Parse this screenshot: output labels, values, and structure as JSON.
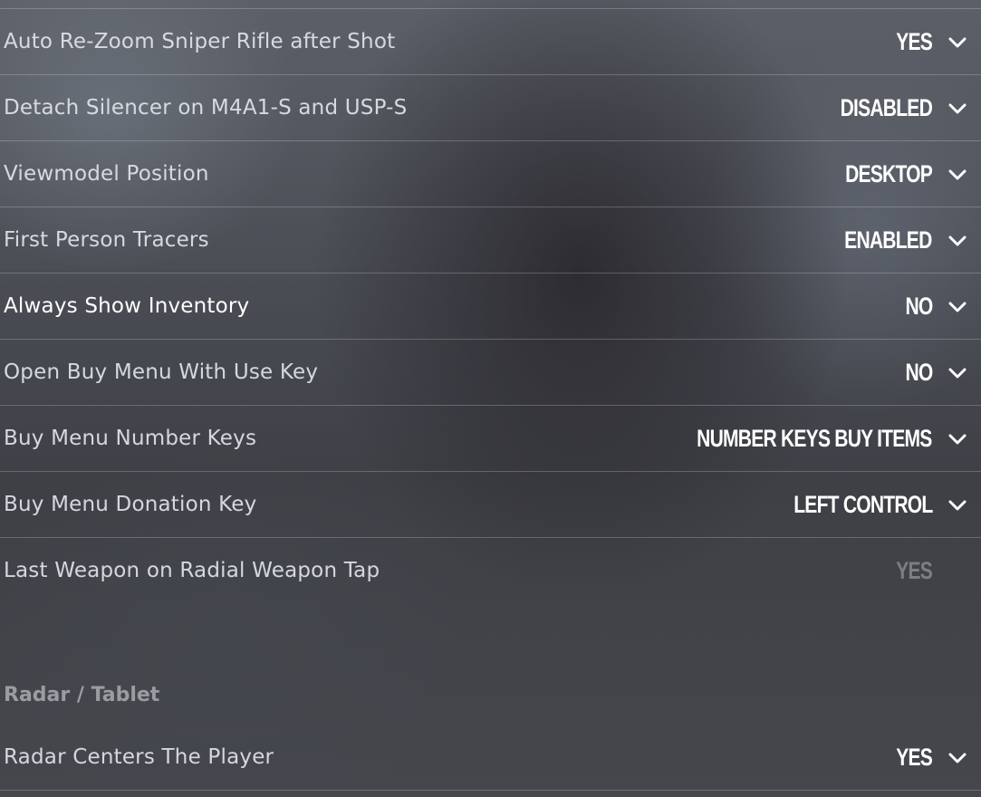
{
  "settings": [
    {
      "label": "Auto Re-Zoom Sniper Rifle after Shot",
      "value": "YES",
      "chevron_icon": "chevron-down-icon"
    },
    {
      "label": "Detach Silencer on M4A1-S and USP-S",
      "value": "DISABLED",
      "chevron_icon": "chevron-down-icon"
    },
    {
      "label": "Viewmodel Position",
      "value": "DESKTOP",
      "chevron_icon": "chevron-down-icon"
    },
    {
      "label": "First Person Tracers",
      "value": "ENABLED",
      "chevron_icon": "chevron-down-icon"
    },
    {
      "label": "Always Show Inventory",
      "value": "NO",
      "chevron_icon": "chevron-down-icon"
    },
    {
      "label": "Open Buy Menu With Use Key",
      "value": "NO",
      "chevron_icon": "chevron-down-icon"
    },
    {
      "label": "Buy Menu Number Keys",
      "value": "NUMBER KEYS BUY ITEMS",
      "chevron_icon": "chevron-down-icon"
    },
    {
      "label": "Buy Menu Donation Key",
      "value": "LEFT CONTROL",
      "chevron_icon": "chevron-down-icon"
    },
    {
      "label": "Last Weapon on Radial Weapon Tap",
      "value": "YES",
      "disabled": true
    }
  ],
  "radar_section": {
    "title": "Radar / Tablet",
    "settings": [
      {
        "label": "Radar Centers The Player",
        "value": "YES",
        "chevron_icon": "chevron-down-icon"
      }
    ]
  },
  "colors": {
    "text_value": "#ffffff",
    "text_label": "#e1e4ea",
    "text_disabled": "#9a9a9a",
    "section_title": "#aaacb2"
  }
}
